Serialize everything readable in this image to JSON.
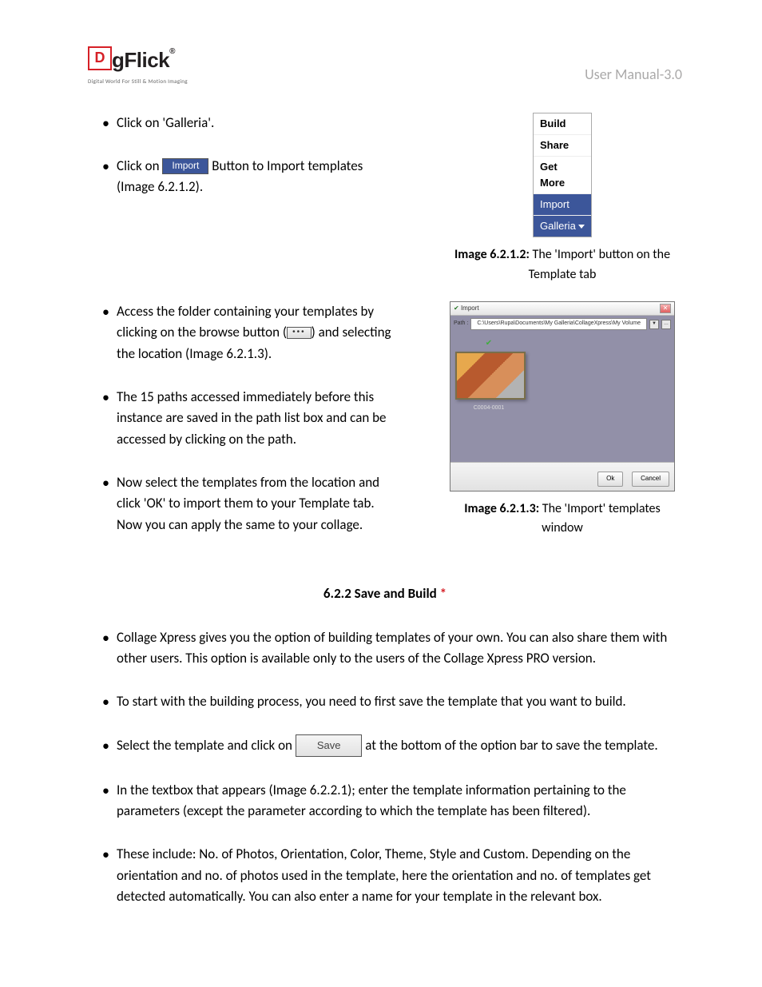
{
  "header": {
    "brand_initial": "D",
    "brand_rest": "gFlick",
    "brand_reg": "®",
    "tagline": "Digital World For Still & Motion Imaging",
    "manual_label": "User Manual-3.0"
  },
  "section1": {
    "li1": "Click on 'Galleria'.",
    "li2_pre": "Click on ",
    "li2_btn": "Import",
    "li2_post": " Button to Import templates (Image 6.2.1.2).",
    "menu": {
      "build": "Build",
      "share": "Share",
      "getmore": "Get More",
      "import": "Import",
      "galleria": "Galleria"
    },
    "caption1_b": "Image 6.2.1.2:",
    "caption1_rest": " The 'Import' button on the Template tab"
  },
  "section2": {
    "li1_pre": "Access the folder containing your templates by clicking on the browse button (",
    "li1_btn": "•••",
    "li1_post": ") and selecting the location (Image 6.2.1.3).",
    "li2": "The 15 paths accessed immediately before this instance are saved in the path list box and can be accessed by clicking on the path.",
    "li3": "Now select the templates from the location and click 'OK' to import them to your Template tab. Now you can apply the same to your collage.",
    "window": {
      "title_icon": "✔",
      "title": "Import",
      "path_label": "Path :",
      "path_value": "C:\\Users\\Rupa\\Documents\\My Galleria\\CollageXpress\\My Volume",
      "thumb_label": "C0004-0001",
      "ok": "Ok",
      "cancel": "Cancel"
    },
    "caption2_b": "Image 6.2.1.3:",
    "caption2_rest": " The 'Import' templates window"
  },
  "heading622": {
    "num": "6.2.2 Save and Build",
    "star": " *"
  },
  "section3": {
    "li1": "Collage Xpress gives you the option of building templates of your own. You can also share them with other users. This option is available only to the users of the Collage Xpress PRO version.",
    "li2": "To start with the building process, you need to first save the template that you want to build.",
    "li3_pre": "Select the template and click on ",
    "li3_btn": "Save",
    "li3_post": " at the bottom of the option bar to save the template.",
    "li4": "In the textbox that appears (Image 6.2.2.1); enter the template information pertaining to the parameters (except the parameter according to which the template has been filtered).",
    "li5": "These include: No. of Photos, Orientation, Color, Theme, Style and Custom. Depending on the orientation and no. of photos used in the template, here the orientation and no. of templates get detected automatically. You can also enter a name for your template in the relevant box."
  }
}
